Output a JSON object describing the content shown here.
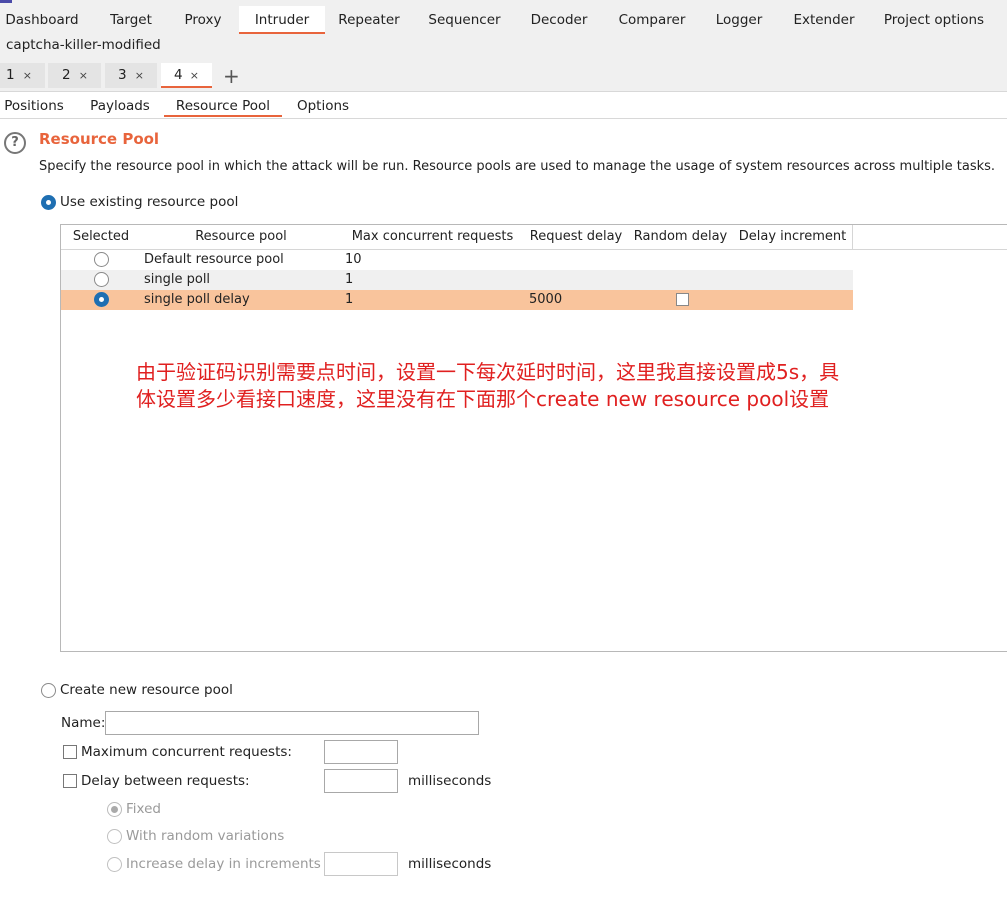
{
  "main_tabs": [
    {
      "label": "Dashboard"
    },
    {
      "label": "Target"
    },
    {
      "label": "Proxy"
    },
    {
      "label": "Intruder"
    },
    {
      "label": "Repeater"
    },
    {
      "label": "Sequencer"
    },
    {
      "label": "Decoder"
    },
    {
      "label": "Comparer"
    },
    {
      "label": "Logger"
    },
    {
      "label": "Extender"
    },
    {
      "label": "Project options"
    }
  ],
  "active_main_tab": "Intruder",
  "extension_title": "captcha-killer-modified",
  "attack_tabs": [
    {
      "label": "1",
      "close": "×"
    },
    {
      "label": "2",
      "close": "×"
    },
    {
      "label": "3",
      "close": "×"
    },
    {
      "label": "4",
      "close": "×"
    }
  ],
  "add_tab_label": "+",
  "sub_tabs": [
    {
      "label": "Positions"
    },
    {
      "label": "Payloads"
    },
    {
      "label": "Resource Pool"
    },
    {
      "label": "Options"
    }
  ],
  "active_sub_tab": "Resource Pool",
  "section": {
    "help_icon": "?",
    "title": "Resource Pool",
    "description": "Specify the resource pool in which the attack will be run. Resource pools are used to manage the usage of system resources across multiple tasks."
  },
  "use_existing": {
    "label": "Use existing resource pool",
    "selected": true
  },
  "table": {
    "columns": [
      "Selected",
      "Resource pool",
      "Max concurrent requests",
      "Request delay",
      "Random delay",
      "Delay increment"
    ],
    "rows": [
      {
        "selected": false,
        "name": "Default resource pool",
        "max": "10",
        "delay": "",
        "random_delay": null,
        "increment": ""
      },
      {
        "selected": false,
        "name": "single poll",
        "max": "1",
        "delay": "",
        "random_delay": null,
        "increment": ""
      },
      {
        "selected": true,
        "name": "single poll delay",
        "max": "1",
        "delay": "5000",
        "random_delay": false,
        "increment": ""
      }
    ]
  },
  "annotation": "由于验证码识别需要点时间，设置一下每次延时时间，这里我直接设置成5s，具体设置多少看接口速度，这里没有在下面那个create new resource pool设置",
  "create_new": {
    "label": "Create new resource pool",
    "name_label": "Name:",
    "name_value": "",
    "max_concurrent_label": "Maximum concurrent requests:",
    "max_concurrent_value": "",
    "delay_label": "Delay between requests:",
    "delay_value": "",
    "delay_unit": "milliseconds",
    "fixed_label": "Fixed",
    "random_label": "With random variations",
    "increase_label": "Increase delay in increments of",
    "increase_value": "",
    "increase_unit": "milliseconds"
  },
  "colors": {
    "accent": "#e8643c",
    "selected_row": "#f9c49c",
    "annotation": "#e02020",
    "radio_on": "#1f6fb2"
  }
}
